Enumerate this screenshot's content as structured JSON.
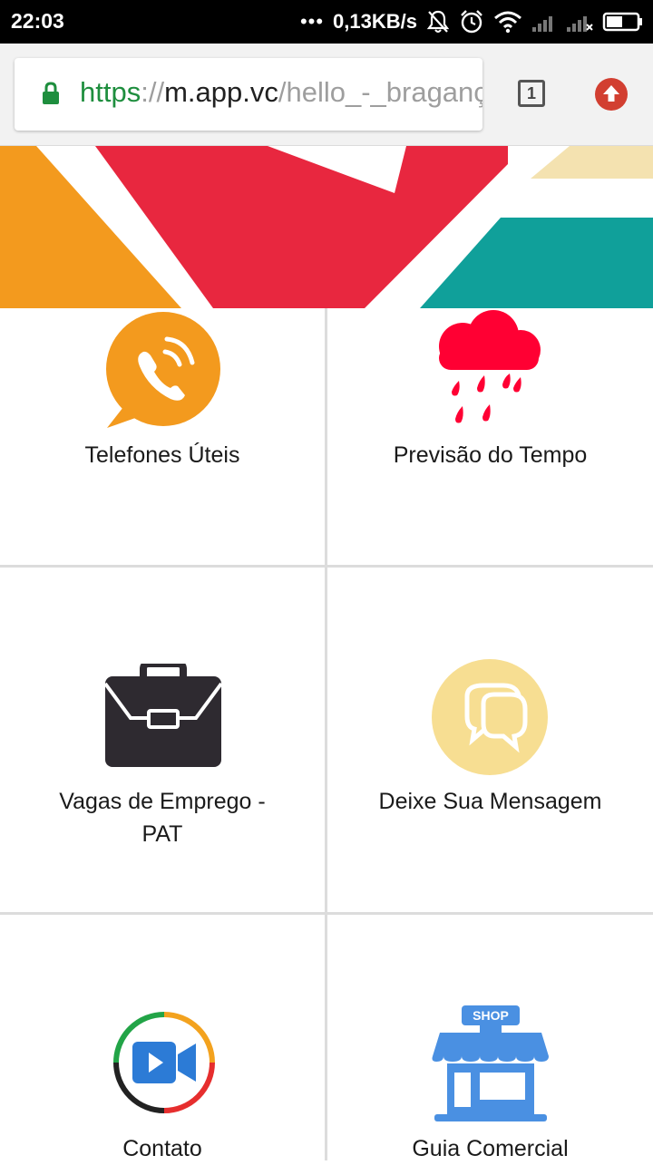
{
  "status_bar": {
    "time": "22:03",
    "dots": "•••",
    "net_speed": "0,13KB/s",
    "icons": [
      "mute-bell-icon",
      "alarm-icon",
      "wifi-icon",
      "signal-icon",
      "signal-no-sim-icon",
      "battery-icon"
    ]
  },
  "browser": {
    "url_scheme": "https",
    "url_sep": "://",
    "url_host": "m.app.vc",
    "url_path": "/hello_-_bragança",
    "tab_count": "1",
    "icons": [
      "lock-icon",
      "update-arrow-icon"
    ]
  },
  "colors": {
    "orange": "#F39A1E",
    "red": "#E8273F",
    "teal": "#10A09A",
    "sand": "#F4E2B0",
    "rain_red": "#FF0033",
    "briefcase": "#2E2A30",
    "chat_yellow": "#F7DE92",
    "shop_blue": "#4A90E2"
  },
  "tiles": [
    {
      "label": "Telefones Úteis",
      "icon": "phone-chat-icon"
    },
    {
      "label": "Previsão do Tempo",
      "icon": "rain-cloud-icon"
    },
    {
      "label": "Vagas de Emprego - PAT",
      "icon": "briefcase-icon"
    },
    {
      "label": "Deixe Sua Mensagem",
      "icon": "chat-bubbles-icon"
    },
    {
      "label": "Contato",
      "icon": "video-camera-icon"
    },
    {
      "label": "Guia Comercial",
      "icon": "shop-icon",
      "sign": "SHOP"
    }
  ]
}
